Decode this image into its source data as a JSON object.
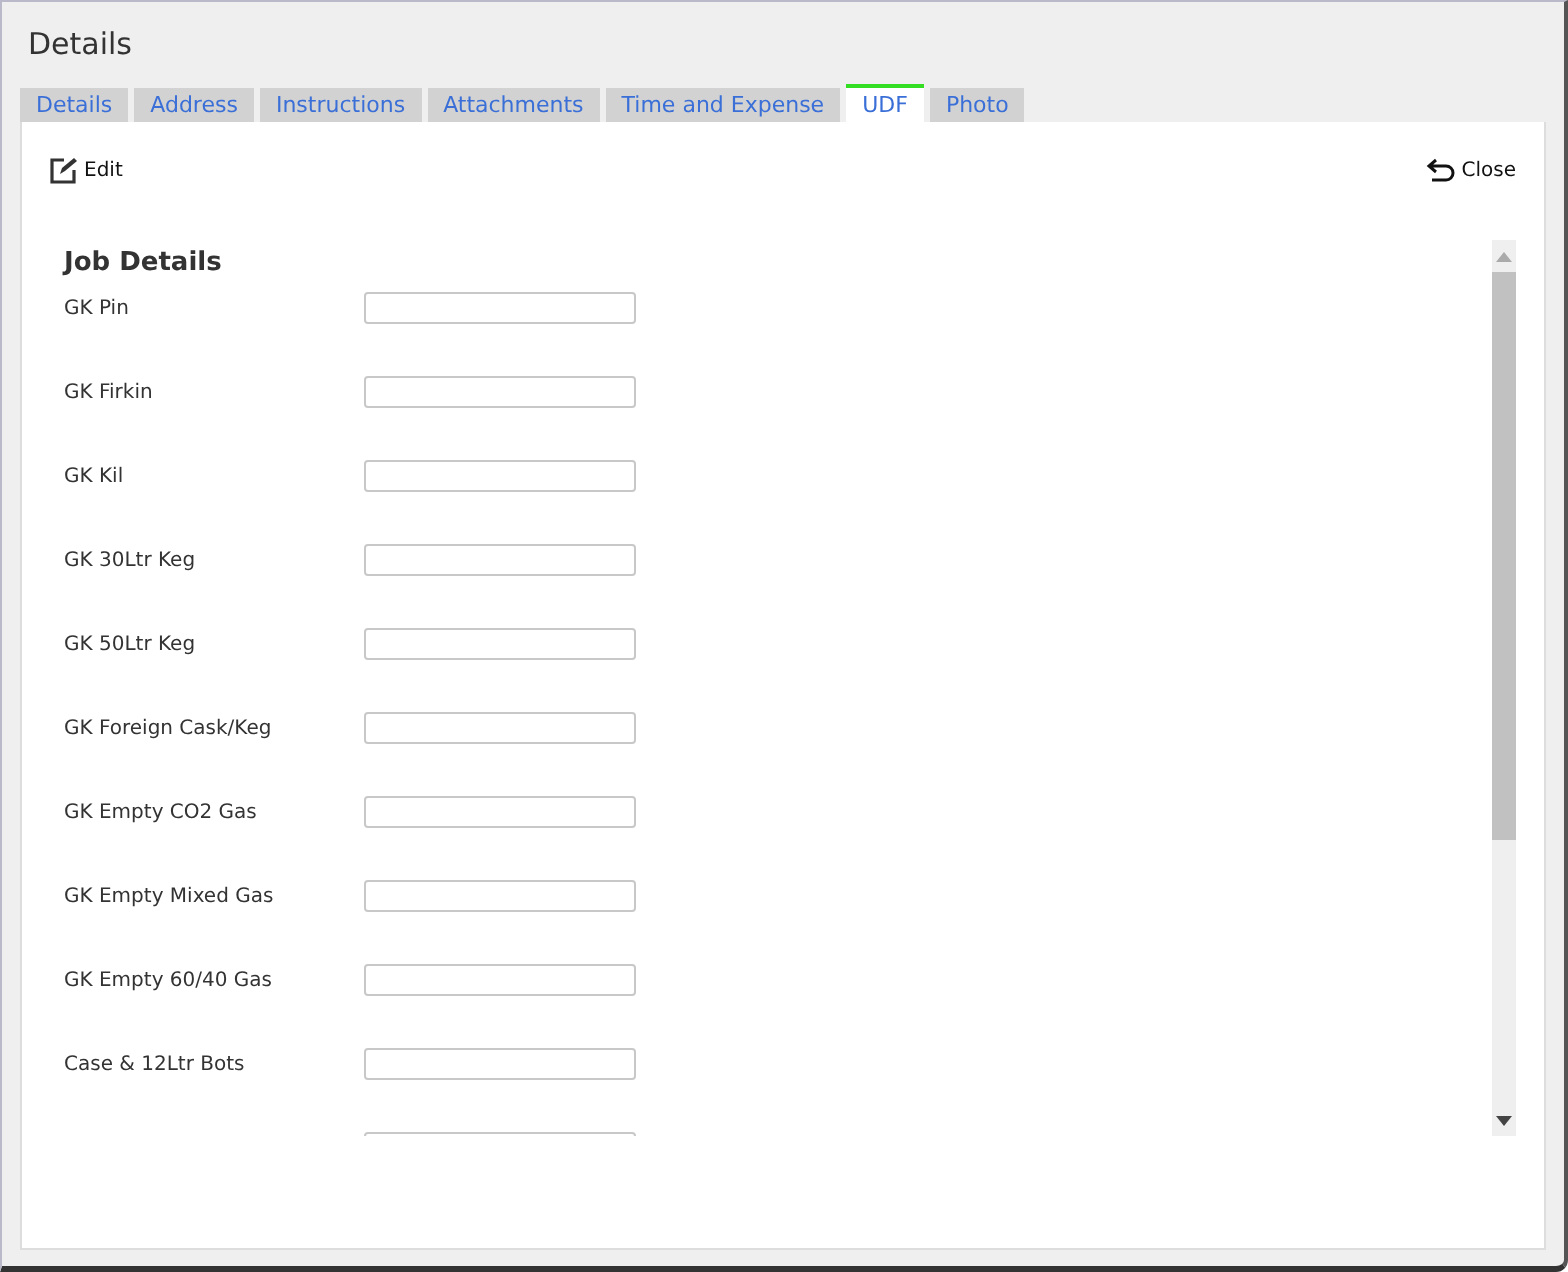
{
  "window": {
    "title": "Details"
  },
  "tabs": [
    {
      "label": "Details",
      "selected": false
    },
    {
      "label": "Address",
      "selected": false
    },
    {
      "label": "Instructions",
      "selected": false
    },
    {
      "label": "Attachments",
      "selected": false
    },
    {
      "label": "Time and Expense",
      "selected": false
    },
    {
      "label": "UDF",
      "selected": true
    },
    {
      "label": "Photo",
      "selected": false
    }
  ],
  "toolbar": {
    "edit": "Edit",
    "close": "Close"
  },
  "section": {
    "title": "Job Details"
  },
  "fields": [
    {
      "kind": "labeled",
      "label": "GK Pin"
    },
    {
      "kind": "labeled",
      "label": "GK Firkin"
    },
    {
      "kind": "labeled",
      "label": "GK Kil"
    },
    {
      "kind": "labeled",
      "label": "GK 30Ltr Keg"
    },
    {
      "kind": "labeled",
      "label": "GK 50Ltr Keg"
    },
    {
      "kind": "labeled",
      "label": "GK Foreign Cask/Keg"
    },
    {
      "kind": "labeled",
      "label": "GK Empty CO2 Gas"
    },
    {
      "kind": "labeled",
      "label": "GK Empty Mixed Gas"
    },
    {
      "kind": "labeled",
      "label": "GK Empty 60/40 Gas"
    },
    {
      "kind": "labeled",
      "label": "Case & 12Ltr Bots"
    },
    {
      "kind": "unlabeled"
    }
  ]
}
